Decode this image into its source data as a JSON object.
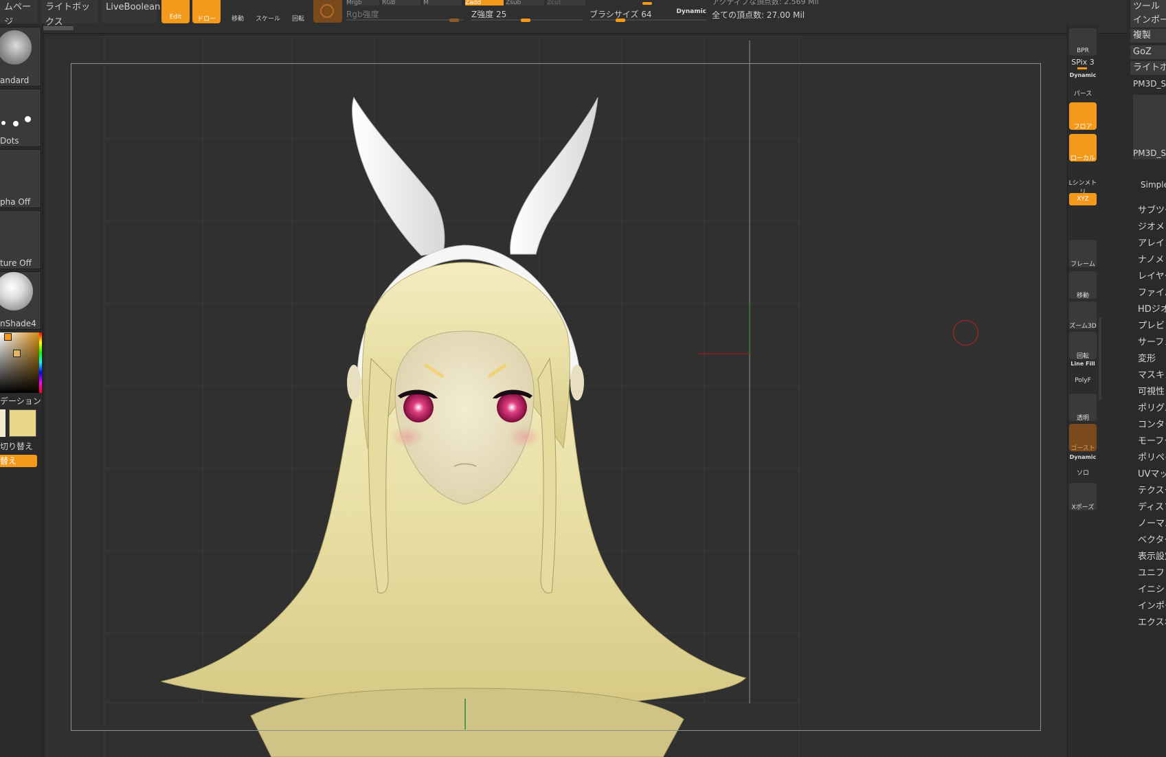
{
  "topbar": {
    "tab_page": "ムページ",
    "tab_lightbox": "ライトボックス",
    "tab_liveboolean": "LiveBoolean",
    "edit_label": "Edit",
    "draw_label": "ドロー",
    "move_label": "移動",
    "scale_label": "スケール",
    "rotate_label": "回転",
    "mrgb_label": "Mrgb",
    "rgb_label": "RGB",
    "m_label": "M",
    "zadd_label": "Zadd",
    "zsub_label": "Zsub",
    "zcut_label": "Zcut",
    "rgb_intensity_label": "Rgb強度",
    "z_intensity_label": "Z強度 25",
    "brush_size_label": "ブラシサイズ 64",
    "dynamic_label": "Dynamic",
    "active_points": "アクティブな頂点数: 2.569 Mil",
    "total_points": "全ての頂点数: 27.00 Mil"
  },
  "left_shelf": {
    "brush_label": "andard",
    "stroke_label": "Dots",
    "alpha_label": "pha Off",
    "texture_label": "ture Off",
    "material_label": "nShade4",
    "gradient_label": "デーション",
    "swap_label": "切り替え",
    "swap_button": "替え"
  },
  "right_shelf": {
    "bpr": "BPR",
    "spix": "SPix 3",
    "perspective_top": "Dynamic",
    "perspective": "パース",
    "floor": "フロア",
    "local": "ローカル",
    "lsym": "Lシンメトリ",
    "xyz": "XYZ",
    "frame": "フレーム",
    "move": "移動",
    "zoom3d": "ズーム3D",
    "rotate": "回転",
    "linefill": "Line Fill",
    "polyf": "PolyF",
    "transp": "透明",
    "ghost": "ゴースト",
    "solo_top": "Dynamic",
    "solo": "ソロ",
    "xpose": "Xポーズ"
  },
  "right_panel": {
    "tool": "ツール",
    "import": "インポー",
    "clone": "複製",
    "goz": "GoZ",
    "lightbox": "ライトボ",
    "tool_name": "PM3D_S",
    "thumb_label": "PM3D_S",
    "simple": "Simple",
    "items": [
      "サブツー",
      "ジオメト",
      "アレイメ",
      "ナノメッ",
      "レイヤー",
      "ファイバ",
      "HDジオメ",
      "プレビュ",
      "サーフェ",
      "変形",
      "マスキン",
      "可視性",
      "ポリグル",
      "コンタク",
      "モーフタ",
      "ポリペイ",
      "UVマッ",
      "テクスチ",
      "ディスプ",
      "ノーマル",
      "ベクター",
      "表示設定",
      "ユニファ",
      "イニシャ",
      "インポー",
      "エクスポ"
    ]
  },
  "colors": {
    "accent": "#f39a1c",
    "hair": "#ebe2a8",
    "ears": "#f2f2f0",
    "skin": "#ece4c6",
    "eyes": "#d6206a"
  }
}
